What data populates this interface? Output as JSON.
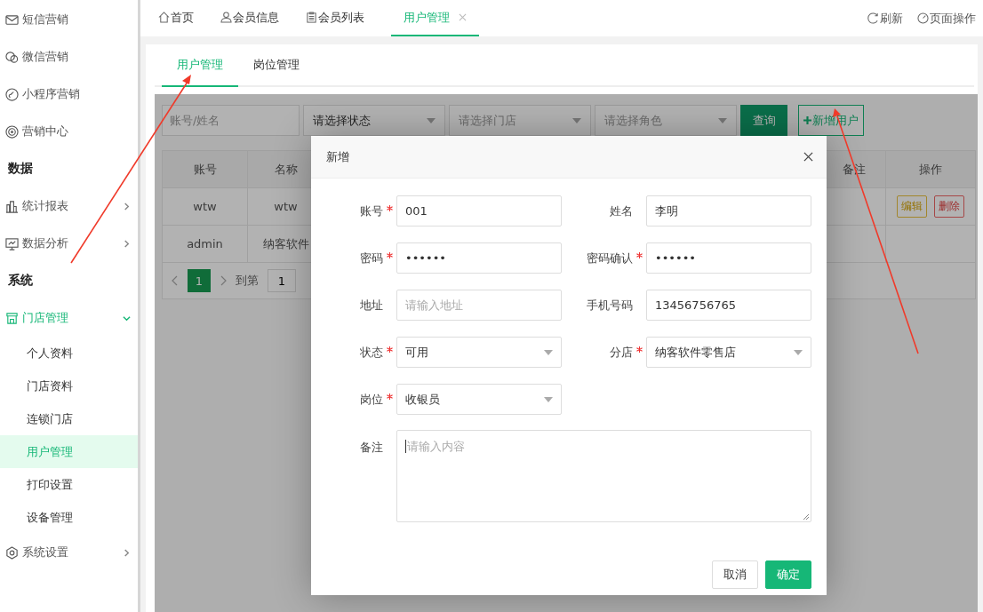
{
  "sidebar": {
    "items": [
      {
        "kind": "link",
        "label": "短信营销"
      },
      {
        "kind": "link",
        "label": "微信营销"
      },
      {
        "kind": "link",
        "label": "小程序营销"
      },
      {
        "kind": "link",
        "label": "营销中心"
      },
      {
        "kind": "section",
        "label": "数据"
      },
      {
        "kind": "group",
        "label": "统计报表",
        "expanded": false
      },
      {
        "kind": "group",
        "label": "数据分析",
        "expanded": false
      },
      {
        "kind": "section",
        "label": "系统"
      },
      {
        "kind": "group",
        "label": "门店管理",
        "expanded": true,
        "children": [
          {
            "label": "个人资料",
            "selected": false
          },
          {
            "label": "门店资料",
            "selected": false
          },
          {
            "label": "连锁门店",
            "selected": false
          },
          {
            "label": "用户管理",
            "selected": true
          },
          {
            "label": "打印设置",
            "selected": false
          },
          {
            "label": "设备管理",
            "selected": false
          }
        ]
      },
      {
        "kind": "group",
        "label": "系统设置",
        "expanded": false
      }
    ]
  },
  "tabs": [
    {
      "label": "首页",
      "selected": false
    },
    {
      "label": "会员信息",
      "selected": false
    },
    {
      "label": "会员列表",
      "selected": false
    },
    {
      "label": "用户管理",
      "selected": true
    }
  ],
  "top_actions": [
    "刷新",
    "页面操作"
  ],
  "sub_tabs": [
    {
      "label": "用户管理",
      "selected": true
    },
    {
      "label": "岗位管理",
      "selected": false
    }
  ],
  "filters": {
    "search": {
      "placeholder": "账号/姓名"
    },
    "selects": [
      {
        "value": "请选择状态"
      },
      {
        "placeholder": "请选择门店"
      },
      {
        "placeholder": "请选择角色"
      }
    ],
    "query_button": "查询",
    "add_button": "新增用户"
  },
  "table": {
    "columns": [
      "账号",
      "名称",
      "备注",
      "操作"
    ],
    "rows": [
      {
        "cells": [
          "wtw",
          "wtw"
        ],
        "actions": [
          {
            "kind": "edit",
            "label": "编辑"
          },
          {
            "kind": "delete",
            "label": "删除"
          }
        ]
      },
      {
        "cells": [
          "admin",
          "纳客软件"
        ],
        "actions": []
      }
    ]
  },
  "pagination": {
    "pages": [
      {
        "label": "1",
        "selected": true
      }
    ],
    "goto_label": "到第",
    "goto_value": "1"
  },
  "dialog": {
    "title": "新增",
    "fields": [
      {
        "label": "账号",
        "required": true,
        "kind": "input",
        "value": "001"
      },
      {
        "label": "姓名",
        "required": false,
        "kind": "input",
        "value": "李明"
      },
      {
        "label": "密码",
        "required": true,
        "kind": "input",
        "value": "••••••"
      },
      {
        "label": "密码确认",
        "required": true,
        "kind": "input",
        "value": "••••••"
      },
      {
        "label": "地址",
        "required": false,
        "kind": "input",
        "placeholder": "请输入地址"
      },
      {
        "label": "手机号码",
        "required": false,
        "kind": "input",
        "value": "13456756765"
      },
      {
        "label": "状态",
        "required": true,
        "kind": "select",
        "value": "可用"
      },
      {
        "label": "分店",
        "required": true,
        "kind": "select",
        "value": "纳客软件零售店"
      },
      {
        "label": "岗位",
        "required": true,
        "kind": "select",
        "value": "收银员"
      },
      {
        "label": "备注",
        "required": false,
        "kind": "textarea",
        "placeholder": "请输入内容"
      }
    ],
    "buttons": [
      {
        "kind": "secondary",
        "label": "取消"
      },
      {
        "kind": "primary",
        "label": "确定"
      }
    ]
  }
}
